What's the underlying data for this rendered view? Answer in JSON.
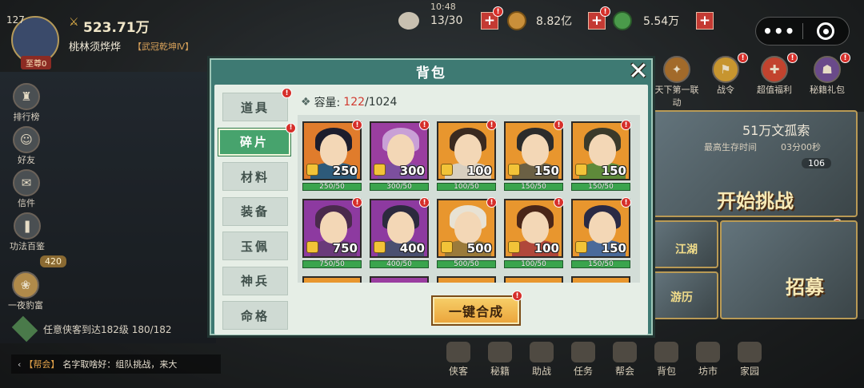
{
  "player": {
    "level": "127",
    "power": "523.71万",
    "name": "桃林须烨烨",
    "title": "【武冠乾坤Ⅳ】",
    "rank": "至尊0"
  },
  "clock": {
    "time": "10:48",
    "stamina": "13/30"
  },
  "resources": {
    "gold": "8.82亿",
    "jade": "5.54万"
  },
  "left_menu": [
    {
      "label": "排行榜",
      "icon": "trophy-icon"
    },
    {
      "label": "好友",
      "icon": "friends-icon"
    },
    {
      "label": "信件",
      "icon": "mail-icon"
    },
    {
      "label": "功法百鉴",
      "icon": "book-icon"
    }
  ],
  "left_bottom": {
    "counter": "420",
    "event": "一夜豹富",
    "quest": "任意侠客到达182级 180/182",
    "guild_tag": "【帮会】",
    "chat": "名字取啥好：组队挑战，来大"
  },
  "right_top": [
    {
      "label": "天下第一联动",
      "icon": "event-icon"
    },
    {
      "label": "战令",
      "icon": "battlepass-icon"
    },
    {
      "label": "超值福利",
      "icon": "gift-icon"
    },
    {
      "label": "秘籍礼包",
      "icon": "package-icon"
    }
  ],
  "right_panel": {
    "reward": "51万文孤索",
    "survival_label": "最高生存时间",
    "survival_time": "03分00秒",
    "cost": "106",
    "challenge": "开始挑战",
    "banner1": "江湖",
    "banner2": "游历",
    "recruit": "招募"
  },
  "bottom_nav": [
    "侠客",
    "秘籍",
    "助战",
    "任务",
    "帮会",
    "背包",
    "坊市",
    "家园"
  ],
  "dialog": {
    "title": "背包",
    "capacity_label": "容量:",
    "capacity_used": "122",
    "capacity_total": "/1024",
    "tabs": [
      "道具",
      "碎片",
      "材料",
      "装备",
      "玉佩",
      "神兵",
      "命格"
    ],
    "active_tab": "碎片",
    "merge_button": "一键合成",
    "items": [
      {
        "count": "250",
        "progress": "250/50",
        "bg": "#e07c2c",
        "hair": "#1d1d2c",
        "robe": "#2d5a7a",
        "progress_ratio": 1
      },
      {
        "count": "300",
        "progress": "300/50",
        "bg": "#9a3ea0",
        "hair": "#c9a0d6",
        "robe": "#7c4f9e",
        "progress_ratio": 1
      },
      {
        "count": "100",
        "progress": "100/50",
        "bg": "#e8962e",
        "hair": "#3a2a20",
        "robe": "#d8cfc0",
        "progress_ratio": 1
      },
      {
        "count": "150",
        "progress": "150/50",
        "bg": "#e8962e",
        "hair": "#2b2b2b",
        "robe": "#6b6044",
        "progress_ratio": 1
      },
      {
        "count": "150",
        "progress": "150/50",
        "bg": "#e8962e",
        "hair": "#3b3a2a",
        "robe": "#5e8a3a",
        "progress_ratio": 1
      },
      {
        "count": "750",
        "progress": "750/50",
        "bg": "#8d3aa0",
        "hair": "#4a2a4c",
        "robe": "#6a3a7a",
        "progress_ratio": 1
      },
      {
        "count": "400",
        "progress": "400/50",
        "bg": "#8d3aa0",
        "hair": "#2c2a3e",
        "robe": "#4a5070",
        "progress_ratio": 1
      },
      {
        "count": "500",
        "progress": "500/50",
        "bg": "#e8962e",
        "hair": "#e8e2d4",
        "robe": "#9a7a3a",
        "progress_ratio": 1
      },
      {
        "count": "100",
        "progress": "100/50",
        "bg": "#e8962e",
        "hair": "#4a2618",
        "robe": "#b0473a",
        "progress_ratio": 1
      },
      {
        "count": "150",
        "progress": "150/50",
        "bg": "#e8962e",
        "hair": "#2a2a44",
        "robe": "#4a6a9a",
        "progress_ratio": 1
      }
    ],
    "partial_row_bg": [
      "#e8962e",
      "#9a3ea0",
      "#e8962e",
      "#e8962e",
      "#e8962e"
    ]
  }
}
